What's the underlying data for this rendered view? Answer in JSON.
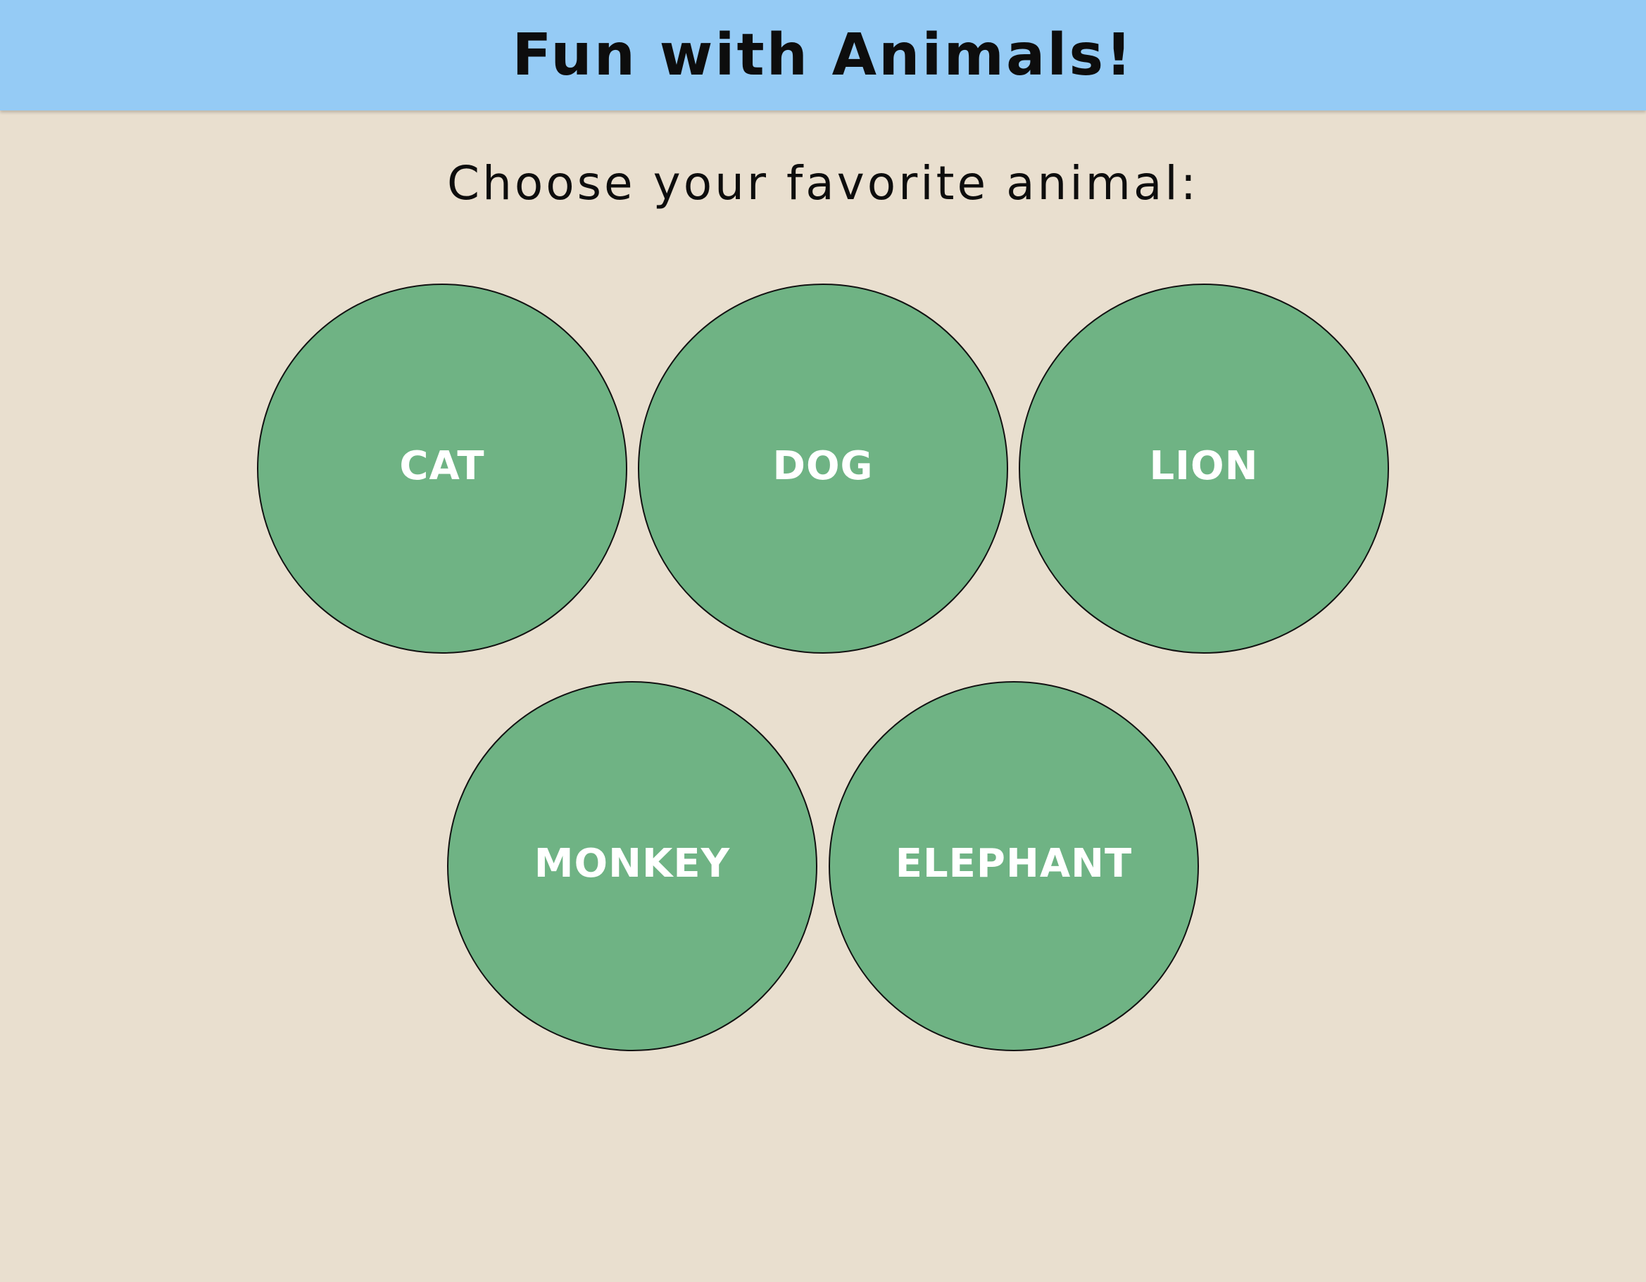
{
  "header": {
    "title": "Fun with Animals!"
  },
  "main": {
    "prompt": "Choose your favorite animal:",
    "animals": [
      {
        "label": "CAT"
      },
      {
        "label": "DOG"
      },
      {
        "label": "LION"
      },
      {
        "label": "MONKEY"
      },
      {
        "label": "ELEPHANT"
      }
    ]
  },
  "colors": {
    "header_bg": "#95cbf5",
    "page_bg": "#e9dfcf",
    "button_bg": "#6fb384",
    "button_text": "#ffffff"
  }
}
